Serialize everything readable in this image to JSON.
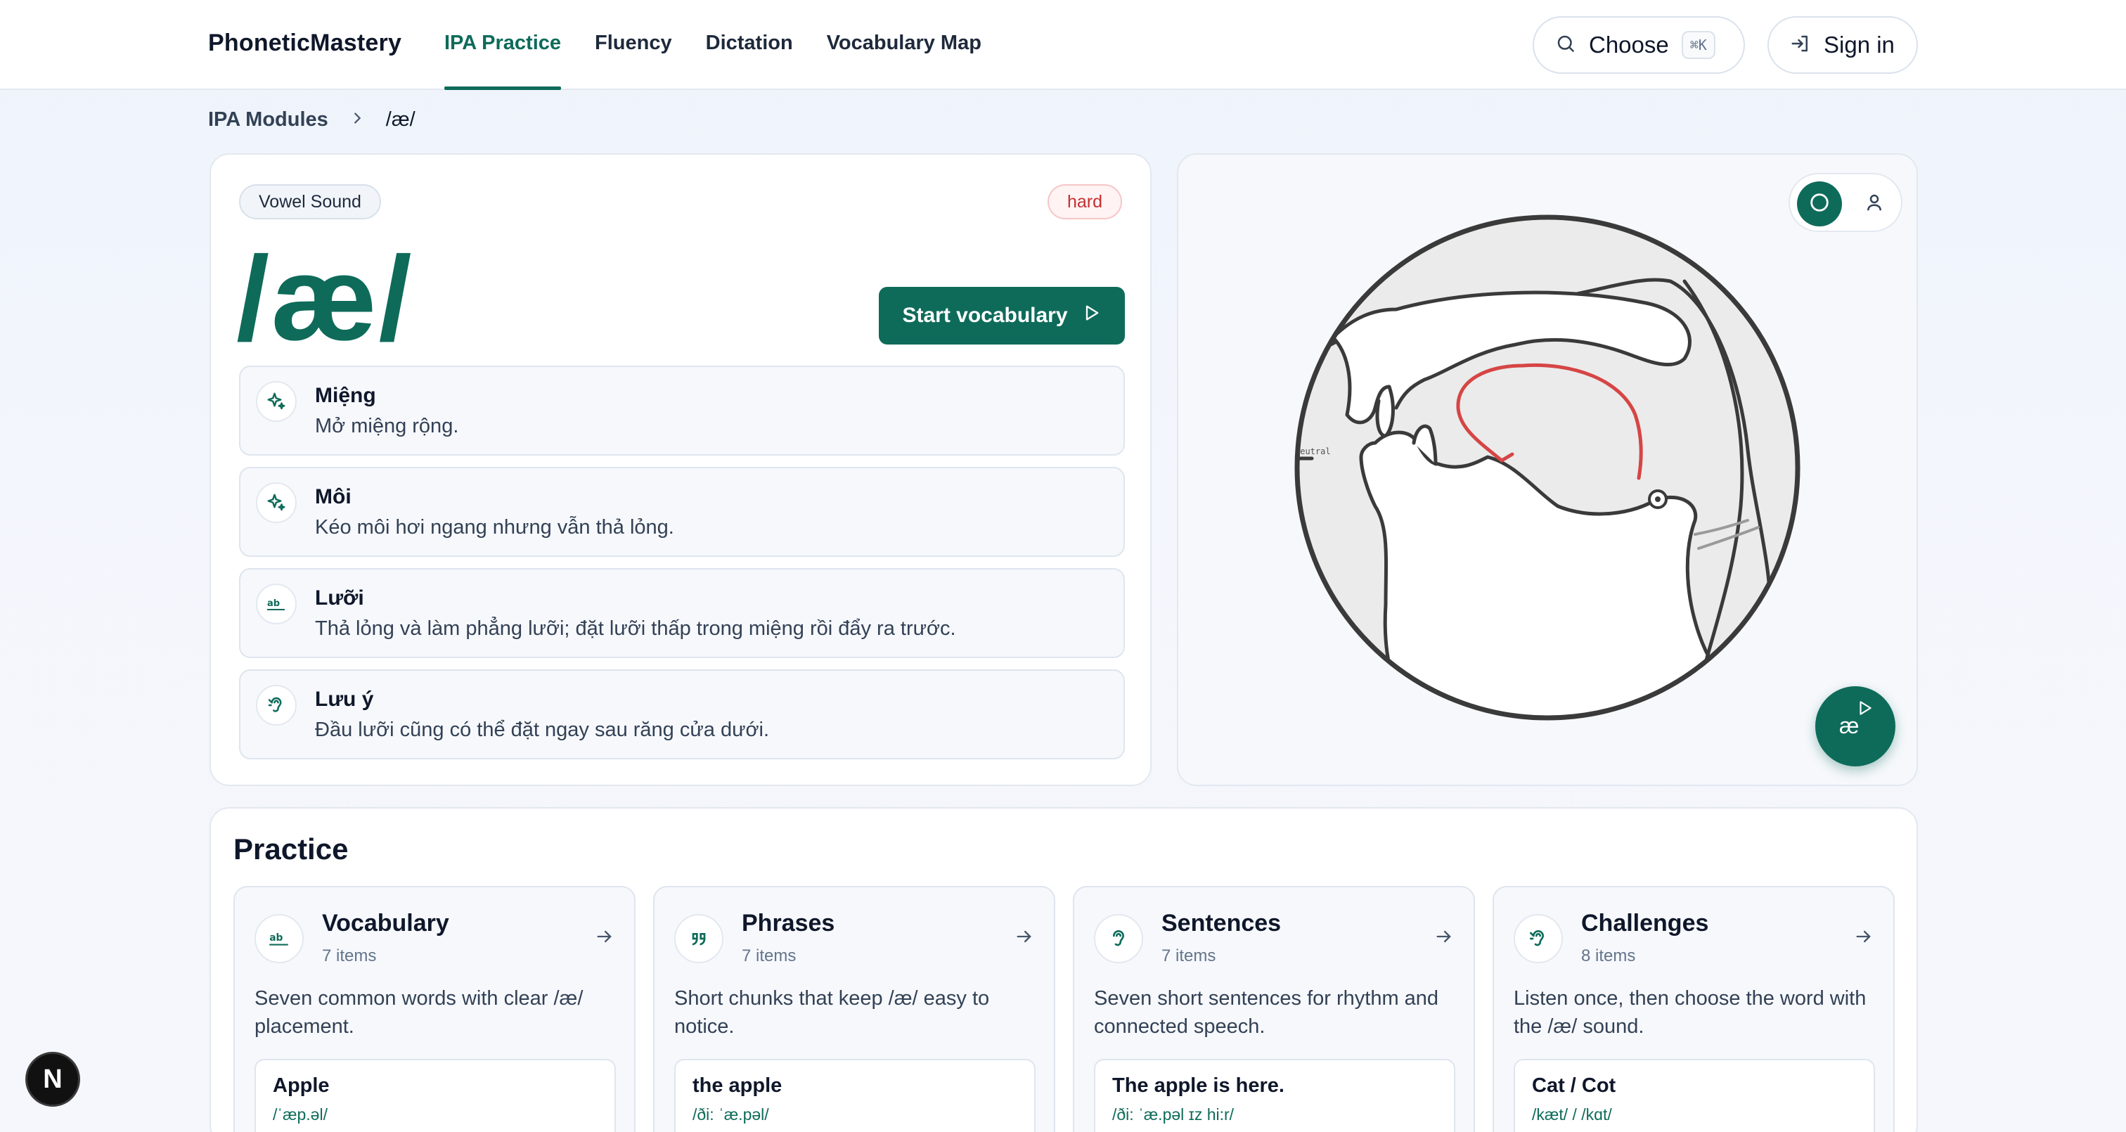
{
  "brand": "PhoneticMastery",
  "nav": {
    "items": [
      {
        "label": "IPA Practice",
        "active": true
      },
      {
        "label": "Fluency",
        "active": false
      },
      {
        "label": "Dictation",
        "active": false
      },
      {
        "label": "Vocabulary Map",
        "active": false
      }
    ],
    "choose_label": "Choose",
    "shortcut": "⌘K",
    "signin_label": "Sign in"
  },
  "breadcrumb": {
    "parent": "IPA Modules",
    "current": "/æ/"
  },
  "sound": {
    "type_badge": "Vowel Sound",
    "difficulty": "hard",
    "ipa": "/æ/",
    "start_label": "Start vocabulary",
    "tips": [
      {
        "icon": "sparkles-icon",
        "title": "Miệng",
        "text": "Mở miệng rộng."
      },
      {
        "icon": "sparkles-icon",
        "title": "Môi",
        "text": "Kéo môi hơi ngang nhưng vẫn thả lỏng."
      },
      {
        "icon": "ab-icon",
        "title": "Lưỡi",
        "text": "Thả lỏng và làm phẳng lưỡi; đặt lưỡi thấp trong miệng rồi đẩy ra trước."
      },
      {
        "icon": "ear-icon",
        "title": "Lưu ý",
        "text": "Đầu lưỡi cũng có thể đặt ngay sau răng cửa dưới."
      }
    ]
  },
  "diagram": {
    "label": "neutral",
    "play_symbol": "æ"
  },
  "practice": {
    "title": "Practice",
    "cards": [
      {
        "icon": "ab-icon",
        "title": "Vocabulary",
        "count": "7 items",
        "desc": "Seven common words with clear /æ/ placement.",
        "sample_word": "Apple",
        "sample_ipa": "/ˈæp.əl/"
      },
      {
        "icon": "quote-icon",
        "title": "Phrases",
        "count": "7 items",
        "desc": "Short chunks that keep /æ/ easy to notice.",
        "sample_word": "the apple",
        "sample_ipa": "/ði: ˈæ.pəl/"
      },
      {
        "icon": "ear-icon",
        "title": "Sentences",
        "count": "7 items",
        "desc": "Seven short sentences for rhythm and connected speech.",
        "sample_word": "The apple is here.",
        "sample_ipa": "/ði: ˈæ.pəl ɪz hi:r/"
      },
      {
        "icon": "ear-icon",
        "title": "Challenges",
        "count": "8 items",
        "desc": "Listen once, then choose the word with the /æ/ sound.",
        "sample_word": "Cat / Cot",
        "sample_ipa": "/kæt/ / /kɑt/"
      }
    ]
  },
  "badge": "N",
  "colors": {
    "accent": "#0e6b5a",
    "hard": "#c53030",
    "tongue_line": "#d64545"
  }
}
